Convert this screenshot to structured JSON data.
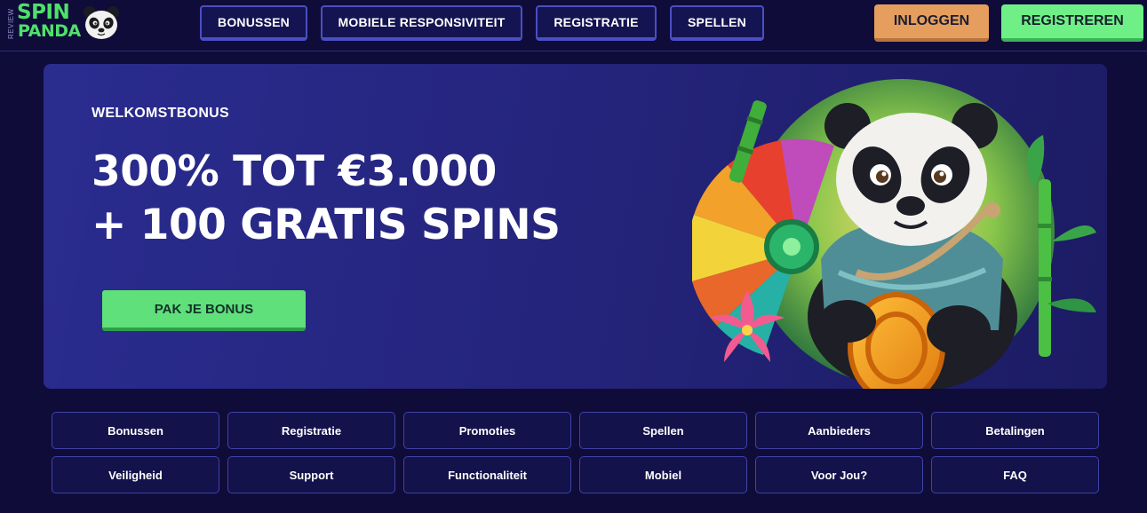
{
  "logo": {
    "review": "REVIEW",
    "line1": "SPIN",
    "line2": "PANDA"
  },
  "nav": {
    "items": [
      {
        "label": "BONUSSEN"
      },
      {
        "label": "MOBIELE RESPONSIVITEIT"
      },
      {
        "label": "REGISTRATIE"
      },
      {
        "label": "SPELLEN"
      }
    ],
    "login_label": "INLOGGEN",
    "register_label": "REGISTREREN"
  },
  "hero": {
    "label": "WELKOMSTBONUS",
    "title_line1": "300% TOT €3.000",
    "title_line2": "+ 100 GRATIS SPINS",
    "cta_label": "PAK JE BONUS"
  },
  "links": [
    {
      "label": "Bonussen"
    },
    {
      "label": "Registratie"
    },
    {
      "label": "Promoties"
    },
    {
      "label": "Spellen"
    },
    {
      "label": "Aanbieders"
    },
    {
      "label": "Betalingen"
    },
    {
      "label": "Veiligheid"
    },
    {
      "label": "Support"
    },
    {
      "label": "Functionaliteit"
    },
    {
      "label": "Mobiel"
    },
    {
      "label": "Voor Jou?"
    },
    {
      "label": "FAQ"
    }
  ],
  "colors": {
    "background": "#0f0c3a",
    "accent_green": "#5fe07a",
    "accent_orange": "#e59e5e",
    "nav_border": "#4a4fc2"
  },
  "icons": {
    "logo": "panda-head-icon",
    "hero_art": "panda-mascot-illustration"
  }
}
